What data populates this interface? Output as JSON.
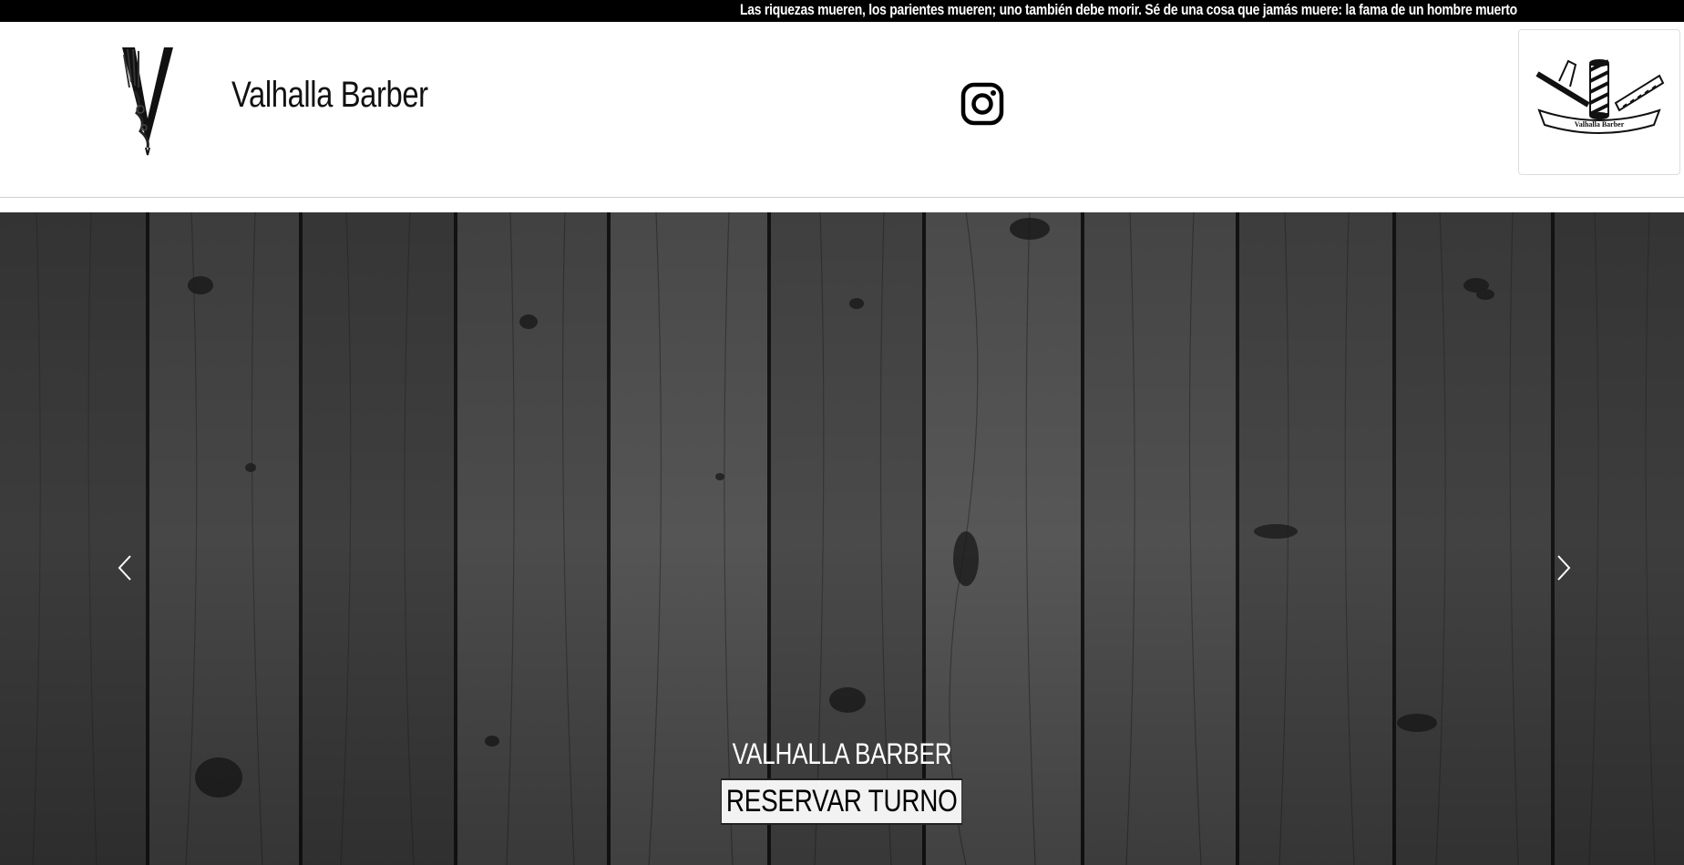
{
  "announcement": {
    "text": "Las riquezas mueren, los parientes mueren; uno también debe morir. Sé de una cosa que jamás muere: la fama de un hombre muerto"
  },
  "header": {
    "brand_name": "Valhalla Barber",
    "logo_icon": "viking-v-axe-icon",
    "social_icon": "instagram-icon",
    "badge": {
      "icon": "barber-pole-razor-comb-icon",
      "banner_text": "Valhalla Barber"
    }
  },
  "hero": {
    "background": "dark-wood-planks",
    "caption_title": "VALHALLA BARBER",
    "cta_label": "RESERVAR TURNO",
    "prev_icon": "chevron-left-icon",
    "next_icon": "chevron-right-icon"
  },
  "colors": {
    "announcement_bg": "#000000",
    "header_bg": "#ffffff",
    "cta_bg": "#f2f2f2",
    "caption_text": "#ffffff"
  }
}
